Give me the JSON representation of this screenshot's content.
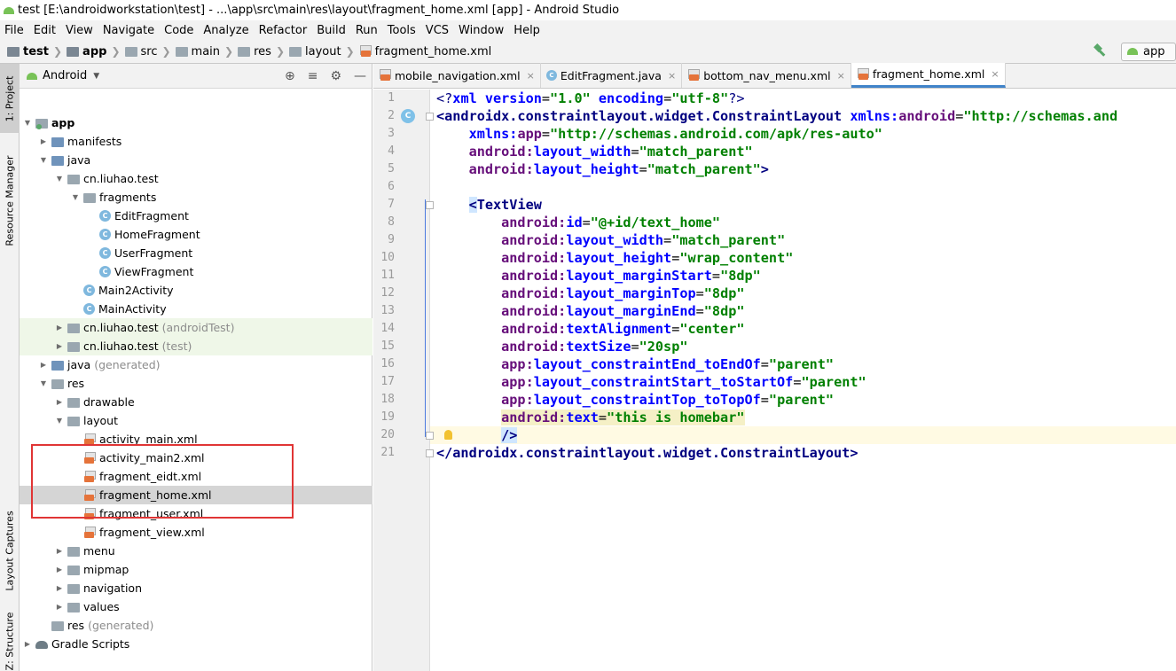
{
  "window": {
    "title": "test [E:\\androidworkstation\\test] - ...\\app\\src\\main\\res\\layout\\fragment_home.xml [app] - Android Studio"
  },
  "menu": [
    "File",
    "Edit",
    "View",
    "Navigate",
    "Code",
    "Analyze",
    "Refactor",
    "Build",
    "Run",
    "Tools",
    "VCS",
    "Window",
    "Help"
  ],
  "breadcrumb": [
    "test",
    "app",
    "src",
    "main",
    "res",
    "layout",
    "fragment_home.xml"
  ],
  "run_config": "app",
  "side_tabs": {
    "project": "1: Project",
    "resource_manager": "Resource Manager",
    "layout_captures": "Layout Captures",
    "structure": "Z: Structure"
  },
  "project_panel": {
    "view_selector": "Android",
    "tree": [
      {
        "label": "app",
        "suffix": ""
      },
      {
        "label": "manifests",
        "suffix": ""
      },
      {
        "label": "java",
        "suffix": ""
      },
      {
        "label": "cn.liuhao.test",
        "suffix": ""
      },
      {
        "label": "fragments",
        "suffix": ""
      },
      {
        "label": "EditFragment",
        "suffix": ""
      },
      {
        "label": "HomeFragment",
        "suffix": ""
      },
      {
        "label": "UserFragment",
        "suffix": ""
      },
      {
        "label": "ViewFragment",
        "suffix": ""
      },
      {
        "label": "Main2Activity",
        "suffix": ""
      },
      {
        "label": "MainActivity",
        "suffix": ""
      },
      {
        "label": "cn.liuhao.test",
        "suffix": "(androidTest)"
      },
      {
        "label": "cn.liuhao.test",
        "suffix": "(test)"
      },
      {
        "label": "java",
        "suffix": "(generated)"
      },
      {
        "label": "res",
        "suffix": ""
      },
      {
        "label": "drawable",
        "suffix": ""
      },
      {
        "label": "layout",
        "suffix": ""
      },
      {
        "label": "activity_main.xml",
        "suffix": ""
      },
      {
        "label": "activity_main2.xml",
        "suffix": ""
      },
      {
        "label": "fragment_eidt.xml",
        "suffix": ""
      },
      {
        "label": "fragment_home.xml",
        "suffix": ""
      },
      {
        "label": "fragment_user.xml",
        "suffix": ""
      },
      {
        "label": "fragment_view.xml",
        "suffix": ""
      },
      {
        "label": "menu",
        "suffix": ""
      },
      {
        "label": "mipmap",
        "suffix": ""
      },
      {
        "label": "navigation",
        "suffix": ""
      },
      {
        "label": "values",
        "suffix": ""
      },
      {
        "label": "res",
        "suffix": "(generated)"
      },
      {
        "label": "Gradle Scripts",
        "suffix": ""
      }
    ]
  },
  "editor_tabs": [
    {
      "label": "mobile_navigation.xml",
      "close": "×",
      "active": false
    },
    {
      "label": "EditFragment.java",
      "close": "×",
      "active": false
    },
    {
      "label": "bottom_nav_menu.xml",
      "close": "×",
      "active": false
    },
    {
      "label": "fragment_home.xml",
      "close": "×",
      "active": true
    }
  ],
  "code": {
    "line_numbers": [
      "1",
      "2",
      "3",
      "4",
      "5",
      "6",
      "7",
      "8",
      "9",
      "10",
      "11",
      "12",
      "13",
      "14",
      "15",
      "16",
      "17",
      "18",
      "19",
      "20",
      "21"
    ],
    "l1": {
      "a": "<?",
      "b": "xml version",
      "c": "=",
      "d": "\"1.0\"",
      "e": " encoding",
      "f": "=",
      "g": "\"utf-8\"",
      "h": "?>"
    },
    "l2": {
      "a": "<androidx.constraintlayout.widget.ConstraintLayout ",
      "b": "xmlns:",
      "c": "android",
      "d": "=",
      "e": "\"http://schemas.and"
    },
    "l3": {
      "a": "    xmlns:",
      "b": "app",
      "c": "=",
      "d": "\"http://schemas.android.com/apk/res-auto\""
    },
    "l4": {
      "a": "    android:",
      "b": "layout_width",
      "c": "=",
      "d": "\"match_parent\""
    },
    "l5": {
      "a": "    android:",
      "b": "layout_height",
      "c": "=",
      "d": "\"match_parent\"",
      "e": ">"
    },
    "l7": {
      "a": "    ",
      "b": "<",
      "c": "TextView"
    },
    "l8": {
      "a": "        android:",
      "b": "id",
      "c": "=",
      "d": "\"@+id/text_home\""
    },
    "l9": {
      "a": "        android:",
      "b": "layout_width",
      "c": "=",
      "d": "\"match_parent\""
    },
    "l10": {
      "a": "        android:",
      "b": "layout_height",
      "c": "=",
      "d": "\"wrap_content\""
    },
    "l11": {
      "a": "        android:",
      "b": "layout_marginStart",
      "c": "=",
      "d": "\"8dp\""
    },
    "l12": {
      "a": "        android:",
      "b": "layout_marginTop",
      "c": "=",
      "d": "\"8dp\""
    },
    "l13": {
      "a": "        android:",
      "b": "layout_marginEnd",
      "c": "=",
      "d": "\"8dp\""
    },
    "l14": {
      "a": "        android:",
      "b": "textAlignment",
      "c": "=",
      "d": "\"center\""
    },
    "l15": {
      "a": "        android:",
      "b": "textSize",
      "c": "=",
      "d": "\"20sp\""
    },
    "l16": {
      "a": "        app:",
      "b": "layout_constraintEnd_toEndOf",
      "c": "=",
      "d": "\"parent\""
    },
    "l17": {
      "a": "        app:",
      "b": "layout_constraintStart_toStartOf",
      "c": "=",
      "d": "\"parent\""
    },
    "l18": {
      "a": "        app:",
      "b": "layout_constraintTop_toTopOf",
      "c": "=",
      "d": "\"parent\""
    },
    "l19": {
      "a": "        ",
      "b": "android:",
      "c": "text",
      "d": "=",
      "e": "\"this is homebar\""
    },
    "l20": {
      "a": "        ",
      "b": "/>"
    },
    "l21": {
      "a": "</androidx.constraintlayout.widget.ConstraintLayout>"
    }
  },
  "colors": {
    "accent": "#4083c9",
    "highlight_box": "#e03535"
  }
}
